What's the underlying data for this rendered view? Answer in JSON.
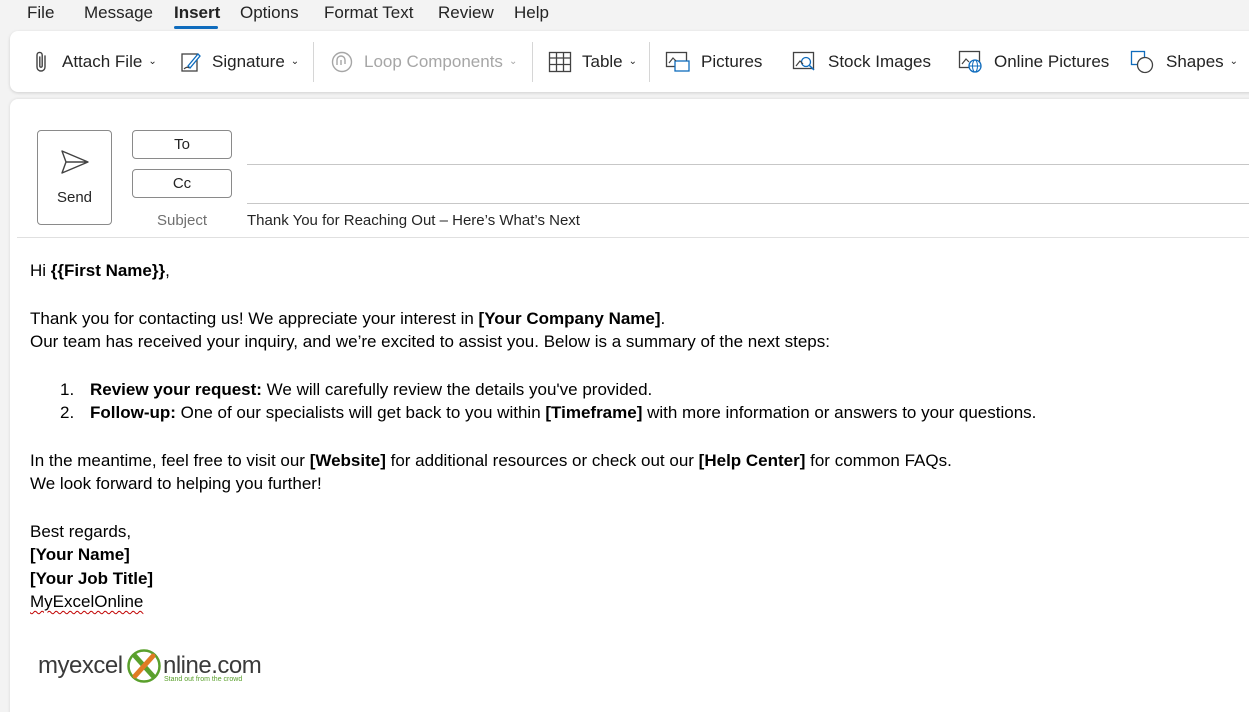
{
  "menu": {
    "items": [
      "File",
      "Message",
      "Insert",
      "Options",
      "Format Text",
      "Review",
      "Help"
    ],
    "active": "Insert"
  },
  "ribbon": {
    "attach_file": "Attach File",
    "signature": "Signature",
    "loop_components": "Loop Components",
    "table": "Table",
    "pictures": "Pictures",
    "stock_images": "Stock Images",
    "online_pictures": "Online Pictures",
    "shapes": "Shapes"
  },
  "compose": {
    "send_label": "Send",
    "to_label": "To",
    "cc_label": "Cc",
    "subject_label": "Subject",
    "subject_value": "Thank You for Reaching Out – Here’s What’s Next"
  },
  "email_body": {
    "greeting_prefix": "Hi ",
    "greeting_name": "{{First Name}}",
    "greeting_suffix": ",",
    "para1_line1_prefix": "Thank you for contacting us! We appreciate your interest in ",
    "para1_company": "[Your Company Name]",
    "para1_line1_suffix": ".",
    "para1_line2": "Our team has received your inquiry, and we’re excited to assist you. Below is a summary of the next steps:",
    "steps": [
      {
        "num": "1.",
        "title": "Review your request:",
        "text": " We will carefully review the details you've provided."
      },
      {
        "num": "2.",
        "title": "Follow-up:",
        "text_before": " One of our specialists will get back to you within ",
        "highlight": "[Timeframe]",
        "text_after": " with more information or answers to your questions."
      }
    ],
    "para2_prefix": "In the meantime, feel free to visit our ",
    "para2_website": "[Website]",
    "para2_middle": " for additional resources or check out our ",
    "para2_help": "[Help Center]",
    "para2_suffix": " for common FAQs.",
    "para2_line2": "We look forward to helping you further!",
    "closing": "Best regards,",
    "name": "[Your Name]",
    "job_title": "[Your Job Title]",
    "company": "MyExcelOnline"
  },
  "logo": {
    "part1": "myexcel",
    "part2": "nline.com",
    "tagline": "Stand out from the crowd"
  },
  "colors": {
    "accent": "#0f6cbd",
    "logo_green": "#5aa02c",
    "spell_underline": "#c00000"
  }
}
